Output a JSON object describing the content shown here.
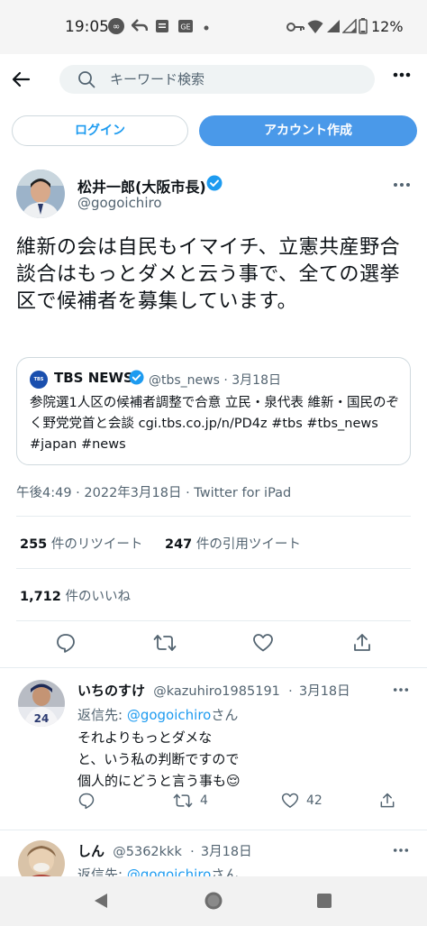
{
  "status_bar": {
    "time": "19:05",
    "battery": "12%"
  },
  "search": {
    "placeholder": "キーワード検索"
  },
  "auth": {
    "login_label": "ログイン",
    "signup_label": "アカウント作成"
  },
  "tweet": {
    "author_name": "松井一郎(大阪市長)",
    "author_handle": "@gogoichiro",
    "text": "維新の会は自民もイマイチ、立憲共産野合談合はもっとダメと云う事で、全ての選挙区で候補者を募集しています。",
    "quote": {
      "logo_text": "TBS NEWS",
      "name": "TBS NEWS",
      "handle": "@tbs_news",
      "date": "3月18日",
      "text": "参院選1人区の候補者調整で合意 立民・泉代表 維新・国民のぞく野党党首と会談 cgi.tbs.co.jp/n/PD4z #tbs #tbs_news #japan #news"
    },
    "timestamp": "午後4:49 · 2022年3月18日 · Twitter for iPad",
    "retweets_count": "255",
    "retweets_label": "件のリツイート",
    "quotes_count": "247",
    "quotes_label": "件の引用ツイート",
    "likes_count": "1,712",
    "likes_label": "件のいいね"
  },
  "replies": [
    {
      "name": "いちのすけ",
      "handle": "@kazuhiro1985191",
      "date": "3月18日",
      "reply_prefix": "返信先: ",
      "reply_to": "@gogoichiro",
      "reply_suffix": "さん",
      "lines": [
        "それよりもっとダメな",
        "と、いう私の判断ですので",
        "個人的にどうと言う事も😌"
      ],
      "retweets": "4",
      "likes": "42"
    },
    {
      "name": "しん",
      "handle": "@5362kkk",
      "date": "3月18日",
      "reply_prefix": "返信先: ",
      "reply_to": "@gogoichiro",
      "reply_suffix": "さん"
    }
  ],
  "icons": {
    "status": [
      "infinity-icon",
      "send-icon",
      "message-icon",
      "gmail-icon",
      "key-icon",
      "wifi-icon",
      "signal-icon",
      "battery-icon"
    ],
    "actions": [
      "reply-icon",
      "retweet-icon",
      "like-icon",
      "share-icon"
    ],
    "nav": [
      "back-nav-icon",
      "home-nav-icon",
      "recents-nav-icon"
    ]
  },
  "colors": {
    "accent": "#1d9bf0",
    "signup_bg": "#4a99e9",
    "text": "#0f1419",
    "secondary": "#536471",
    "border": "#cfd9de"
  }
}
